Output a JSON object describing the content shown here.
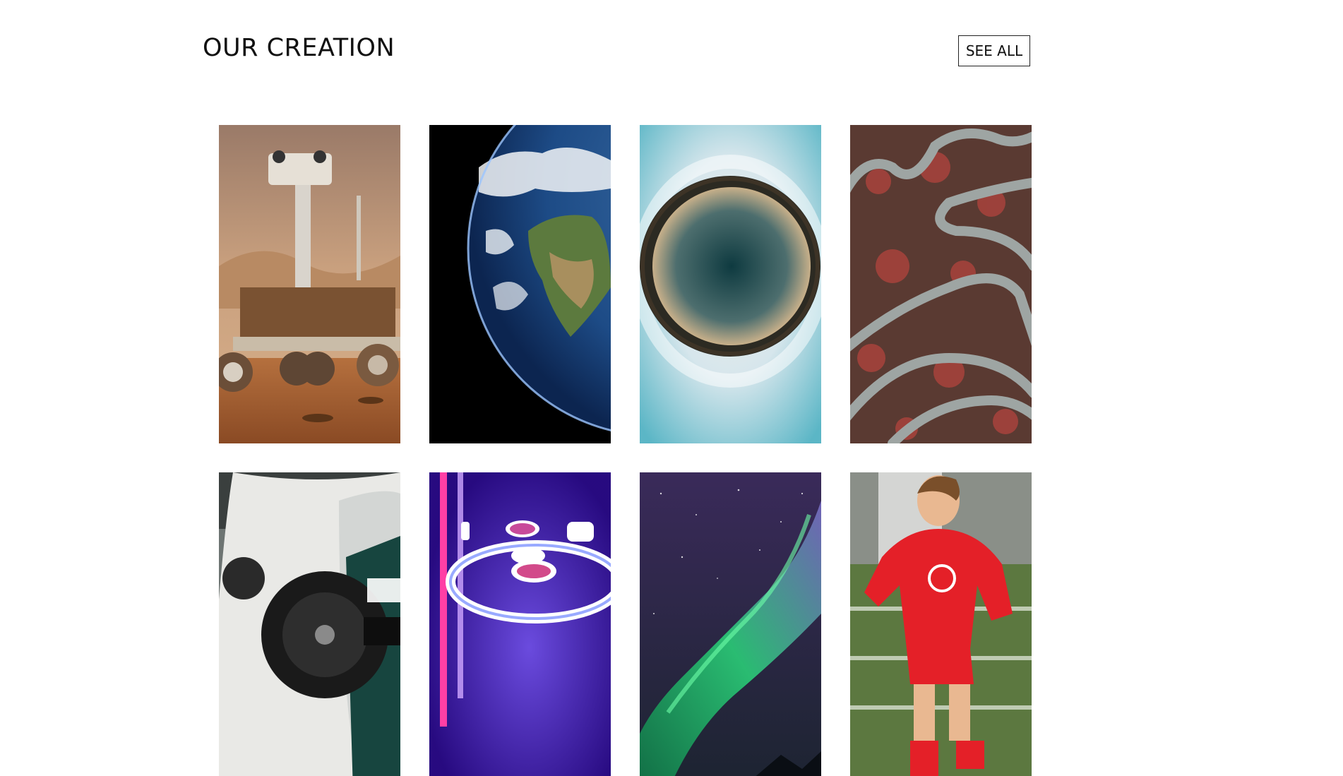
{
  "section": {
    "title": "OUR CREATION",
    "see_all_label": "SEE ALL"
  },
  "gallery": {
    "items": [
      {
        "subject": "mars-rover",
        "image_name": "mars-rover-image"
      },
      {
        "subject": "earth-from-space",
        "image_name": "earth-image"
      },
      {
        "subject": "tiny-planet-panorama",
        "image_name": "tiny-planet-image"
      },
      {
        "subject": "winding-road-aerial",
        "image_name": "winding-road-image"
      },
      {
        "subject": "race-car",
        "image_name": "race-car-image"
      },
      {
        "subject": "skee-ball-neon",
        "image_name": "skee-ball-image"
      },
      {
        "subject": "aurora-borealis",
        "image_name": "aurora-image"
      },
      {
        "subject": "soccer-player",
        "image_name": "soccer-player-image"
      }
    ]
  },
  "colors": {
    "background": "#ffffff",
    "text": "#111111",
    "border": "#222222"
  }
}
